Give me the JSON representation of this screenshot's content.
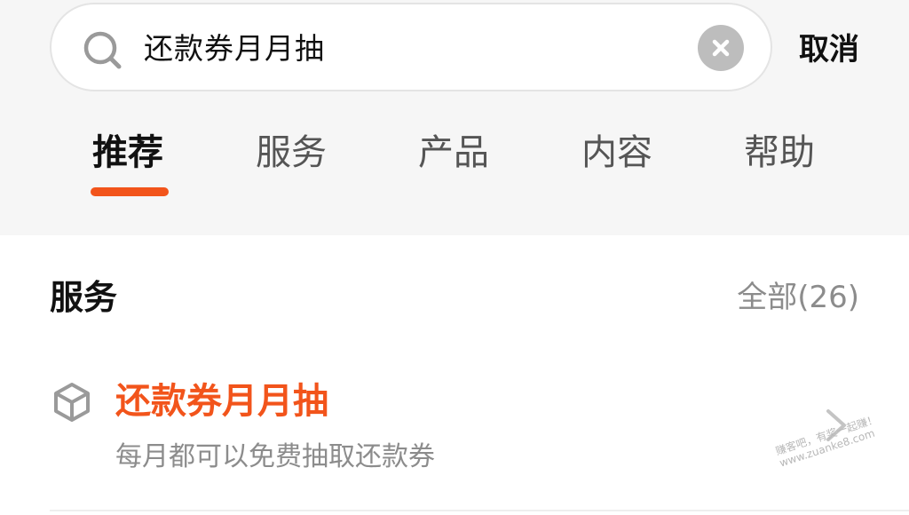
{
  "search": {
    "query": "还款券月月抽",
    "cancel_label": "取消"
  },
  "tabs": [
    {
      "label": "推荐",
      "active": true
    },
    {
      "label": "服务",
      "active": false
    },
    {
      "label": "产品",
      "active": false
    },
    {
      "label": "内容",
      "active": false
    },
    {
      "label": "帮助",
      "active": false
    }
  ],
  "section": {
    "title": "服务",
    "see_all": "全部(26)"
  },
  "results": [
    {
      "icon": "cube-icon",
      "title": "还款券月月抽",
      "description": "每月都可以免费抽取还款券"
    }
  ],
  "watermark": {
    "line1": "赚客吧，有奖一起赚！",
    "line2": "www.zuanke8.com"
  },
  "colors": {
    "accent": "#f2541b",
    "background_top": "#f6f6f6",
    "muted_text": "#8c8c8c"
  }
}
